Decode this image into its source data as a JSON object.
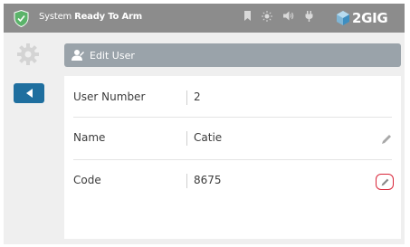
{
  "status_bar": {
    "prefix": "System",
    "state": "Ready To Arm",
    "icons": [
      "shield-icon",
      "bookmark-icon",
      "brightness-icon",
      "volume-icon",
      "power-plug-icon"
    ],
    "brand": "2GIG",
    "colors": {
      "bar": "#8c8c8c",
      "shield": "#5bb36a"
    }
  },
  "sidebar": {
    "settings_icon": "gear-icon",
    "back_icon": "back-arrow-icon",
    "back_color": "#1f6f9f"
  },
  "header": {
    "title": "Edit User",
    "icon": "user-edit-icon"
  },
  "fields": [
    {
      "label": "User Number",
      "value": "2",
      "editable": false
    },
    {
      "label": "Name",
      "value": "Catie",
      "editable": true
    },
    {
      "label": "Code",
      "value": "8675",
      "editable": true,
      "highlighted": true
    }
  ],
  "colors": {
    "highlight": "#d9273a"
  }
}
